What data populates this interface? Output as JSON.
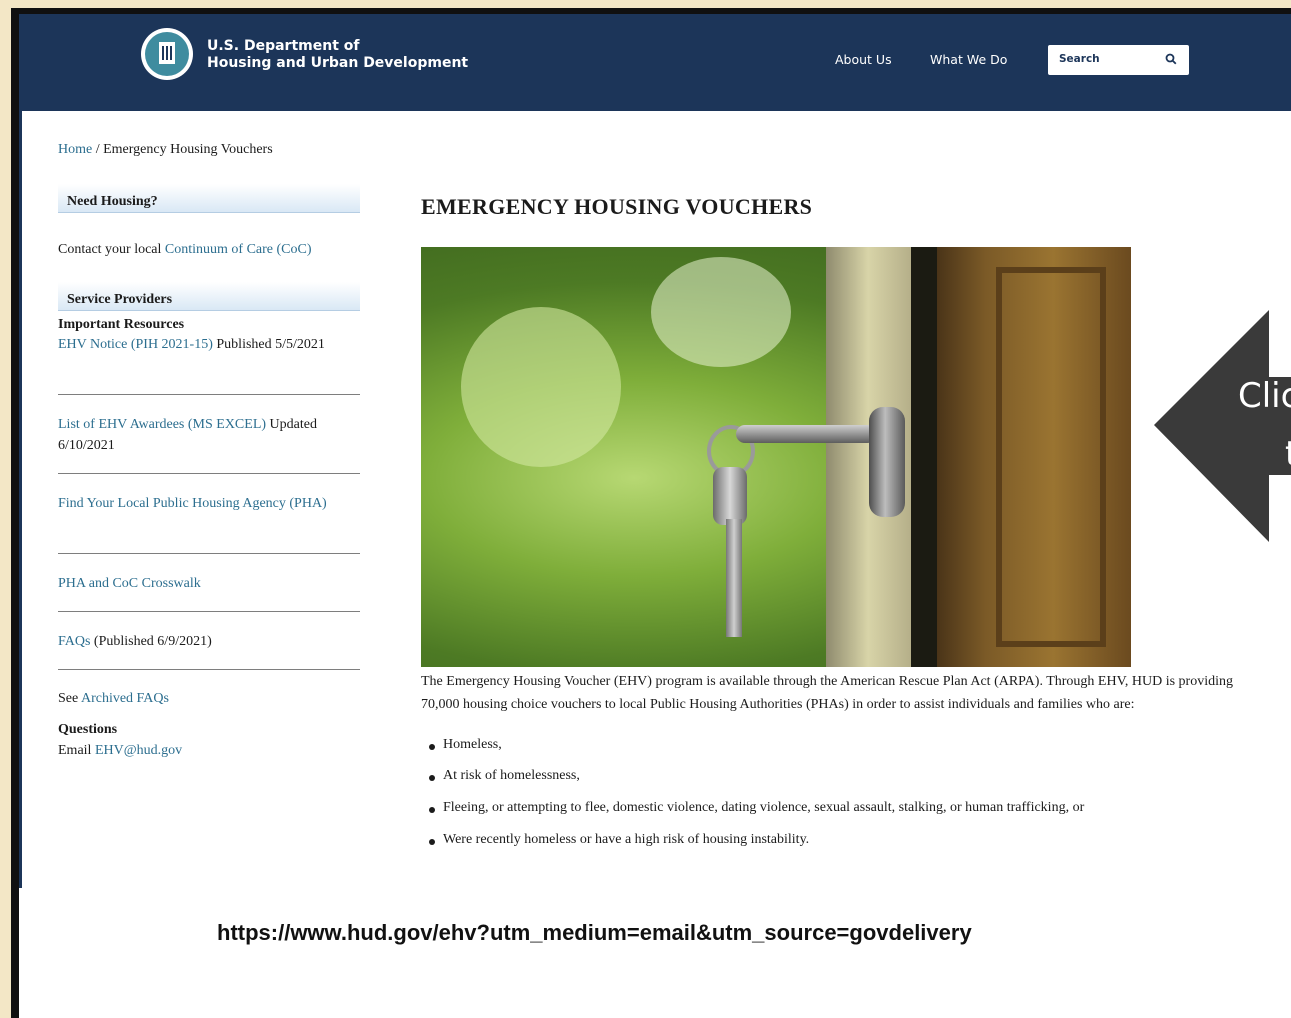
{
  "header": {
    "agency_line1": "U.S. Department of",
    "agency_line2": "Housing and Urban Development",
    "nav": [
      "About Us",
      "What We Do"
    ],
    "search_placeholder": "Search"
  },
  "breadcrumb": {
    "home": "Home",
    "separator": " / ",
    "current": "Emergency Housing Vouchers"
  },
  "sidebar": {
    "need_housing": {
      "heading": "Need Housing?",
      "contact_prefix": "Contact your local ",
      "contact_link": "Continuum of Care (CoC)"
    },
    "service_providers": {
      "heading": "Service Providers",
      "subheading": "Important Resources",
      "resources": [
        {
          "link": "EHV Notice (PIH 2021-15)",
          "note": " Published 5/5/2021"
        },
        {
          "link": "List of EHV Awardees (MS EXCEL)",
          "note": " Updated 6/10/2021"
        },
        {
          "link": "Find Your Local Public Housing Agency (PHA)",
          "note": ""
        },
        {
          "link": "PHA and CoC Crosswalk",
          "note": ""
        },
        {
          "link": "FAQs",
          "note": " (Published 6/9/2021)"
        }
      ],
      "archived_prefix": "See ",
      "archived_link": "Archived FAQs",
      "questions_heading": "Questions",
      "email_prefix": "Email ",
      "email_link": "EHV@hud.gov"
    }
  },
  "main": {
    "title": "EMERGENCY HOUSING VOUCHERS",
    "intro": "The Emergency Housing Voucher (EHV) program is available through the American Rescue Plan Act (ARPA). Through EHV, HUD is providing 70,000 housing choice vouchers to local Public Housing Authorities (PHAs) in order to assist individuals and families who are:",
    "bullets": [
      "Homeless,",
      "At risk of homelessness,",
      "Fleeing, or attempting to flee, domestic violence, dating violence, sexual assault, stalking, or human trafficking, or",
      "Were recently homeless or have a high risk of housing instability."
    ]
  },
  "callout": {
    "line1": "Clic",
    "line2": "t"
  },
  "footer_url": "https://www.hud.gov/ehv?utm_medium=email&utm_source=govdelivery",
  "colors": {
    "header_bg": "#1c3559",
    "link": "#2c6e8f",
    "callout": "#3a3a3a"
  }
}
